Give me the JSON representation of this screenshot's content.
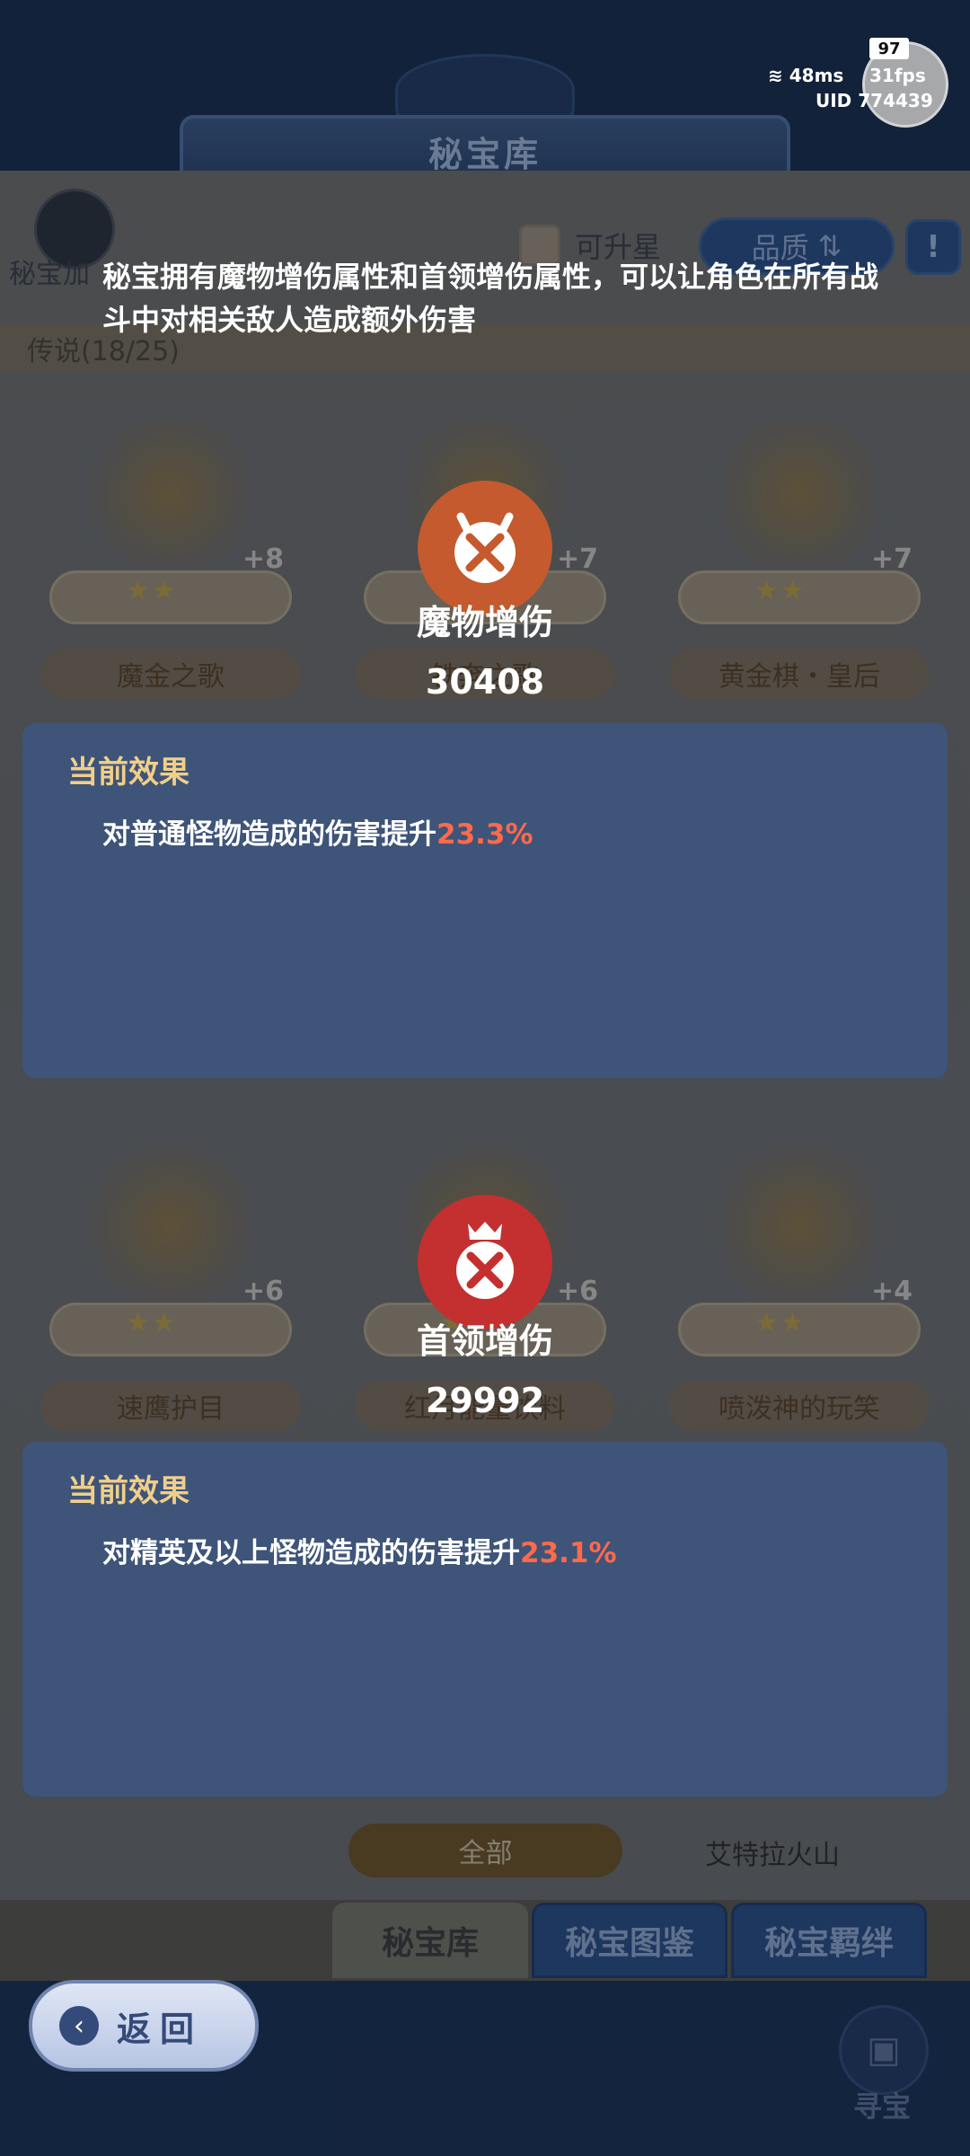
{
  "header": {
    "title": "秘宝库"
  },
  "hud": {
    "counter": "97",
    "ping": "48ms",
    "fps": "31fps",
    "uid": "UID 774439"
  },
  "toolbar": {
    "side_label": "秘宝加",
    "upgradable_label": "可升星",
    "quality_label": "品质",
    "info_label": "!"
  },
  "rarity_label": "传说(18/25)",
  "cards_row1": [
    {
      "name": "魔金之歌",
      "plus": "+8",
      "stars": "★★"
    },
    {
      "name": "铁奔之歌",
      "plus": "+7",
      "stars": "★★"
    },
    {
      "name": "黄金棋・皇后",
      "plus": "+7",
      "stars": "★★"
    }
  ],
  "cards_row2": [
    {
      "name": "速鹰护目",
      "plus": "+6",
      "stars": "★★"
    },
    {
      "name": "红月能量饮料",
      "plus": "+6",
      "stars": "★★"
    },
    {
      "name": "喷泼神的玩笑",
      "plus": "+4",
      "stars": "★★"
    }
  ],
  "intro": "秘宝拥有魔物增伤属性和首领增伤属性，可以让角色在所有战斗中对相关敌人造成额外伤害",
  "monster": {
    "title": "魔物增伤",
    "value": "30408",
    "effect_head": "当前效果",
    "effect_text": "对普通怪物造成的伤害提升",
    "effect_pct": "23.3%"
  },
  "boss": {
    "title": "首领增伤",
    "value": "29992",
    "effect_head": "当前效果",
    "effect_text": "对精英及以上怪物造成的伤害提升",
    "effect_pct": "23.1%"
  },
  "filters": {
    "all": "全部",
    "location": "艾特拉火山"
  },
  "tabs": [
    {
      "label": "秘宝库"
    },
    {
      "label": "秘宝图鉴"
    },
    {
      "label": "秘宝羁绊"
    }
  ],
  "back_label": "返回",
  "treasure_label": "寻宝",
  "colors": {
    "highlight": "#ff6a4a",
    "effect_head": "#f0cf8a",
    "panel": "#3e5479"
  }
}
